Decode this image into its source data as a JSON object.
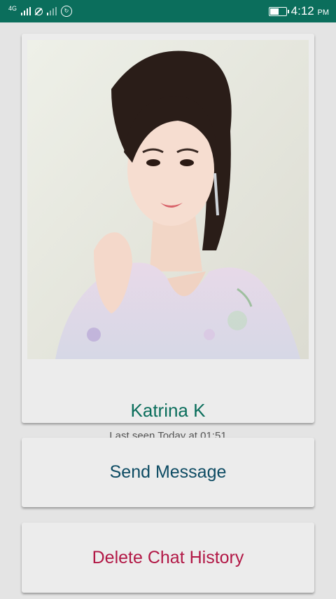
{
  "status_bar": {
    "network_label": "4G",
    "time": "4:12",
    "time_suffix": "PM",
    "battery_level": 0.55,
    "icons": [
      "signal-icon",
      "no-sim-icon",
      "signal-weak-icon",
      "sync-icon",
      "battery-icon"
    ]
  },
  "profile": {
    "name": "Katrina K",
    "last_seen": "Last seen Today at 01:51",
    "photo": "profile-photo"
  },
  "actions": {
    "send_message": "Send Message",
    "delete_history": "Delete Chat History"
  },
  "colors": {
    "accent": "#0b6e5c",
    "send": "#0d4b63",
    "delete": "#b21846",
    "background": "#e4e4e4"
  }
}
